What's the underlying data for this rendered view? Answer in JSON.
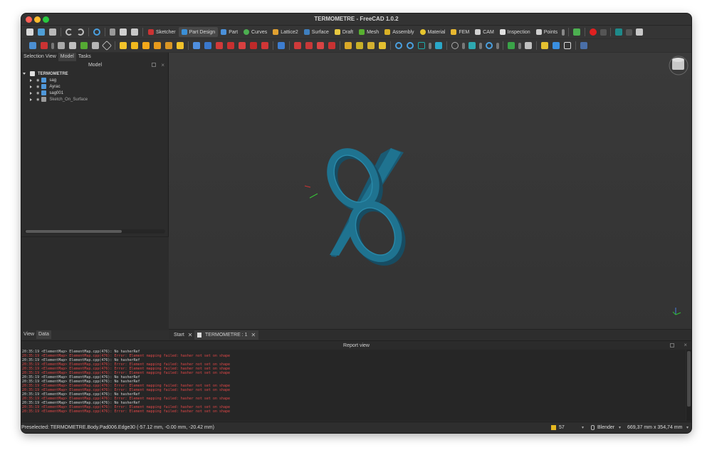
{
  "window": {
    "title": "TERMOMETRE - FreeCAD 1.0.2"
  },
  "workbenches": [
    {
      "label": "Sketcher",
      "color": "#cc3333",
      "active": false
    },
    {
      "label": "Part Design",
      "color": "#3b8fd6",
      "active": true
    },
    {
      "label": "Part",
      "color": "#4a90d9",
      "active": false
    },
    {
      "label": "Curves",
      "color": "#4caf50",
      "active": false
    },
    {
      "label": "Lattice2",
      "color": "#e0a030",
      "active": false
    },
    {
      "label": "Surface",
      "color": "#3f7fbf",
      "active": false
    },
    {
      "label": "Draft",
      "color": "#e8c840",
      "active": false
    },
    {
      "label": "Mesh",
      "color": "#58b030",
      "active": false
    },
    {
      "label": "Assembly",
      "color": "#d9b026",
      "active": false
    },
    {
      "label": "Material",
      "color": "#e6c52e",
      "active": false
    },
    {
      "label": "FEM",
      "color": "#e8b830",
      "active": false
    },
    {
      "label": "CAM",
      "color": "#d0d0d0",
      "active": false
    },
    {
      "label": "Inspection",
      "color": "#e0e0e0",
      "active": false
    },
    {
      "label": "Points",
      "color": "#cfcfcf",
      "active": false
    }
  ],
  "left_panel": {
    "tabs": [
      "Selection View",
      "Model",
      "Tasks"
    ],
    "active_tab": "Model",
    "header": "Model",
    "tree": [
      {
        "label": "TERMOMETRE",
        "expanded": true,
        "level": 0,
        "icon": "document-icon"
      },
      {
        "label": "sag",
        "expanded": false,
        "level": 1,
        "icon": "body-icon"
      },
      {
        "label": "Ayrac",
        "expanded": false,
        "level": 1,
        "icon": "body-icon"
      },
      {
        "label": "sag001",
        "expanded": false,
        "level": 1,
        "icon": "body-icon"
      },
      {
        "label": "Sketch_On_Surface",
        "expanded": false,
        "level": 1,
        "icon": "sketch-icon"
      }
    ],
    "bottom_tabs": [
      "View",
      "Data"
    ],
    "active_bottom_tab": "Data"
  },
  "doc_tabs": [
    {
      "label": "Start",
      "active": false
    },
    {
      "label": "TERMOMETRE : 1",
      "active": true
    }
  ],
  "report_view": {
    "title": "Report view",
    "lines": [
      {
        "text": "20:35:19  <ElementMap> ElementMap.cpp(476): No hasherRef",
        "type": "w"
      },
      {
        "text": "20:35:19  <ElementMap> ElementMap.cpp(476): Error: Element mapping failed: hasher not set on shape",
        "type": "r"
      },
      {
        "text": "20:35:19  <ElementMap> ElementMap.cpp(476): No hasherRef",
        "type": "w"
      },
      {
        "text": "20:35:19  <ElementMap> ElementMap.cpp(476): Error: Element mapping failed: hasher not set on shape",
        "type": "r"
      },
      {
        "text": "20:35:19  <ElementMap> ElementMap.cpp(476): Error: Element mapping failed: hasher not set on shape",
        "type": "r"
      },
      {
        "text": "20:35:19  <ElementMap> ElementMap.cpp(476): Error: Element mapping failed: hasher not set on shape",
        "type": "r"
      },
      {
        "text": "20:35:19  <ElementMap> ElementMap.cpp(476): No hasherRef",
        "type": "w"
      },
      {
        "text": "20:35:19  <ElementMap> ElementMap.cpp(476): No hasherRef",
        "type": "w"
      },
      {
        "text": "20:35:19  <ElementMap> ElementMap.cpp(476): Error: Element mapping failed: hasher not set on shape",
        "type": "r"
      },
      {
        "text": "20:35:19  <ElementMap> ElementMap.cpp(476): Error: Element mapping failed: hasher not set on shape",
        "type": "r"
      },
      {
        "text": "20:35:19  <ElementMap> ElementMap.cpp(476): No hasherRef",
        "type": "w"
      },
      {
        "text": "20:35:19  <ElementMap> ElementMap.cpp(476): Error: Element mapping failed: hasher not set on shape",
        "type": "r"
      },
      {
        "text": "20:35:19  <ElementMap> ElementMap.cpp(476): No hasherRef",
        "type": "w"
      },
      {
        "text": "20:35:19  <ElementMap> ElementMap.cpp(476): Error: Element mapping failed: hasher not set on shape",
        "type": "r"
      },
      {
        "text": "20:35:19  <ElementMap> ElementMap.cpp(476): Error: Element mapping failed: hasher not set on shape",
        "type": "r"
      }
    ]
  },
  "status": {
    "preselected": "Preselected: TERMOMETRE.Body.Pad006.Edge30 (-57.12 mm, -0.00 mm, -20.42 mm)",
    "selection_count": "57",
    "navigation_style": "Blender",
    "dimensions": "669,37 mm x 354,74 mm"
  },
  "colors": {
    "window_bg": "#2f2f2f",
    "viewport_bg": "#383838",
    "model": "#1f6f8f",
    "error_text": "#e04747"
  }
}
